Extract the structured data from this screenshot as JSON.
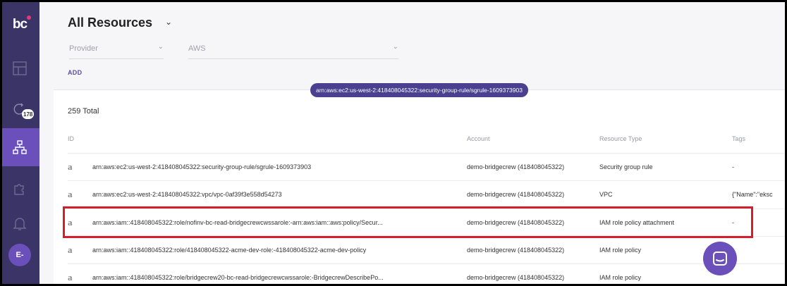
{
  "sidebar": {
    "logo": "bc",
    "alerts_badge": "178",
    "avatar": "E-"
  },
  "header": {
    "title": "All Resources",
    "title_chevron": "⌄"
  },
  "filters": {
    "provider_placeholder": "Provider",
    "provider_value": "AWS",
    "add_label": "ADD"
  },
  "table": {
    "total": "259 Total",
    "columns": {
      "id": "ID",
      "account": "Account",
      "resource_type": "Resource Type",
      "tags": "Tags"
    },
    "rows": [
      {
        "id": "arn:aws:ec2:us-west-2:418408045322:security-group-rule/sgrule-1609373903",
        "account": "demo-bridgecrew (418408045322)",
        "type": "Security group rule",
        "tags": "-"
      },
      {
        "id": "arn:aws:ec2:us-west-2:418408045322:vpc/vpc-0af39f3e558d54273",
        "account": "demo-bridgecrew (418408045322)",
        "type": "VPC",
        "tags": "{\"Name\":\"eksc"
      },
      {
        "id": "arn:aws:iam::418408045322:role/nofinv-bc-read-bridgecrewcwssarole:-arn:aws:iam::aws:policy/Secur...",
        "account": "demo-bridgecrew (418408045322)",
        "type": "IAM role policy attachment",
        "tags": "-"
      },
      {
        "id": "arn:aws:iam::418408045322:role/418408045322-acme-dev-role:-418408045322-acme-dev-policy",
        "account": "demo-bridgecrew (418408045322)",
        "type": "IAM role policy",
        "tags": "-"
      },
      {
        "id": "arn:aws:iam::418408045322:role/bridgecrew20-bc-read-bridgecrewcwssarole:-BridgecrewDescribePo...",
        "account": "demo-bridgecrew (418408045322)",
        "type": "IAM role policy",
        "tags": ""
      }
    ],
    "tooltip": "arn:aws:ec2:us-west-2:418408045322:security-group-rule/sgrule-1609373903"
  },
  "colors": {
    "sidebar": "#3a3566",
    "accent": "#6b4fbb",
    "highlight": "#d31f2d"
  }
}
